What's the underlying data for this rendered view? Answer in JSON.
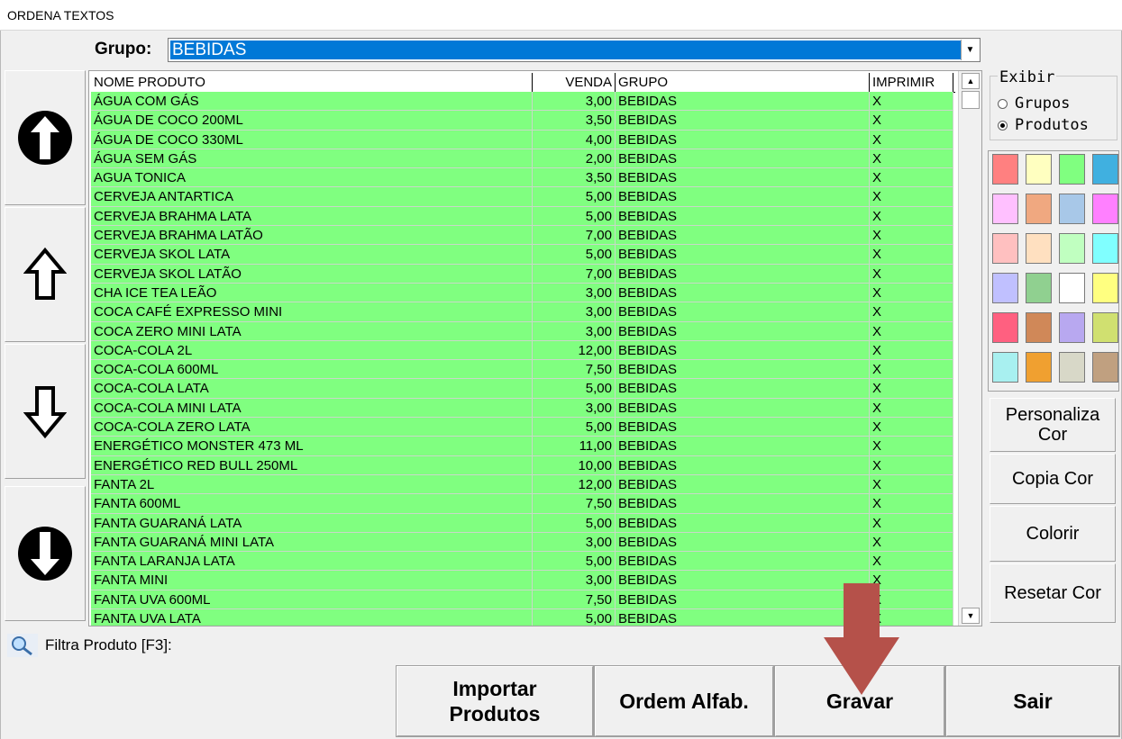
{
  "window": {
    "title": "ORDENA TEXTOS"
  },
  "grupo": {
    "label": "Grupo:",
    "value": "BEBIDAS"
  },
  "nav_buttons": [
    {
      "name": "move-to-top-icon"
    },
    {
      "name": "move-up-icon"
    },
    {
      "name": "move-down-icon"
    },
    {
      "name": "move-to-bottom-icon"
    }
  ],
  "grid": {
    "headers": [
      "NOME PRODUTO",
      "VENDA",
      "GRUPO",
      "IMPRIMIR"
    ],
    "row_color": "#80ff80",
    "rows": [
      [
        "ÁGUA COM GÁS",
        "3,00",
        "BEBIDAS",
        "X"
      ],
      [
        "ÁGUA DE COCO 200ML",
        "3,50",
        "BEBIDAS",
        "X"
      ],
      [
        "ÁGUA DE COCO 330ML",
        "4,00",
        "BEBIDAS",
        "X"
      ],
      [
        "ÁGUA SEM GÁS",
        "2,00",
        "BEBIDAS",
        "X"
      ],
      [
        "AGUA TONICA",
        "3,50",
        "BEBIDAS",
        "X"
      ],
      [
        "CERVEJA ANTARTICA",
        "5,00",
        "BEBIDAS",
        "X"
      ],
      [
        "CERVEJA BRAHMA LATA",
        "5,00",
        "BEBIDAS",
        "X"
      ],
      [
        "CERVEJA BRAHMA LATÃO",
        "7,00",
        "BEBIDAS",
        "X"
      ],
      [
        "CERVEJA SKOL LATA",
        "5,00",
        "BEBIDAS",
        "X"
      ],
      [
        "CERVEJA SKOL LATÃO",
        "7,00",
        "BEBIDAS",
        "X"
      ],
      [
        "CHA ICE TEA LEÃO",
        "3,00",
        "BEBIDAS",
        "X"
      ],
      [
        "COCA CAFÉ EXPRESSO MINI",
        "3,00",
        "BEBIDAS",
        "X"
      ],
      [
        "COCA ZERO MINI LATA",
        "3,00",
        "BEBIDAS",
        "X"
      ],
      [
        "COCA-COLA 2L",
        "12,00",
        "BEBIDAS",
        "X"
      ],
      [
        "COCA-COLA 600ML",
        "7,50",
        "BEBIDAS",
        "X"
      ],
      [
        "COCA-COLA LATA",
        "5,00",
        "BEBIDAS",
        "X"
      ],
      [
        "COCA-COLA MINI LATA",
        "3,00",
        "BEBIDAS",
        "X"
      ],
      [
        "COCA-COLA ZERO LATA",
        "5,00",
        "BEBIDAS",
        "X"
      ],
      [
        "ENERGÉTICO MONSTER 473 ML",
        "11,00",
        "BEBIDAS",
        "X"
      ],
      [
        "ENERGÉTICO RED BULL 250ML",
        "10,00",
        "BEBIDAS",
        "X"
      ],
      [
        "FANTA 2L",
        "12,00",
        "BEBIDAS",
        "X"
      ],
      [
        "FANTA 600ML",
        "7,50",
        "BEBIDAS",
        "X"
      ],
      [
        "FANTA GUARANÁ LATA",
        "5,00",
        "BEBIDAS",
        "X"
      ],
      [
        "FANTA GUARANÁ MINI LATA",
        "3,00",
        "BEBIDAS",
        "X"
      ],
      [
        "FANTA LARANJA LATA",
        "5,00",
        "BEBIDAS",
        "X"
      ],
      [
        "FANTA MINI",
        "3,00",
        "BEBIDAS",
        "X"
      ],
      [
        "FANTA UVA 600ML",
        "7,50",
        "BEBIDAS",
        "X"
      ],
      [
        "FANTA UVA LATA",
        "5,00",
        "BEBIDAS",
        "X"
      ]
    ]
  },
  "exibir": {
    "legend": "Exibir",
    "options": [
      {
        "label": "Grupos",
        "selected": false
      },
      {
        "label": "Produtos",
        "selected": true
      }
    ]
  },
  "palette": [
    [
      "#ff8080",
      "#ffffc0",
      "#80ff80",
      "#40b0e0"
    ],
    [
      "#ffc0ff",
      "#f0a880",
      "#a8c8e8",
      "#ff80ff"
    ],
    [
      "#ffc0c0",
      "#ffe0c0",
      "#c0ffc0",
      "#80ffff"
    ],
    [
      "#c0c0ff",
      "#90d090",
      "#ffffff",
      "#ffff80"
    ],
    [
      "#ff6080",
      "#d08858",
      "#b8a8f0",
      "#d0e070"
    ],
    [
      "#a8f0f0",
      "#f0a030",
      "#d8d8c8",
      "#c0a080"
    ]
  ],
  "side_buttons": {
    "personaliza": "Personaliza Cor",
    "copia": "Copia Cor",
    "colorir": "Colorir",
    "resetar": "Resetar Cor"
  },
  "filter": {
    "label": "Filtra Produto [F3]:"
  },
  "bottom_buttons": {
    "importar": "Importar Produtos",
    "ordem": "Ordem Alfab.",
    "gravar": "Gravar",
    "sair": "Sair"
  },
  "annotation_color": "#b5514a"
}
